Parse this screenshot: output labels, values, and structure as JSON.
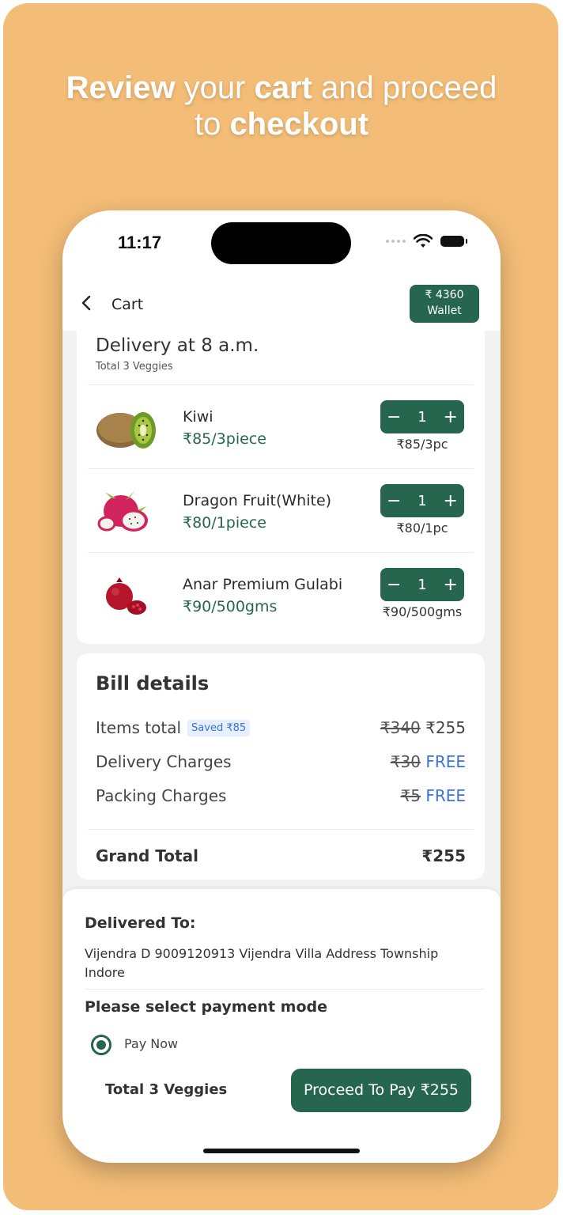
{
  "promo": {
    "w1": "Review",
    "w2": " your ",
    "w3": "cart",
    "w4": " and proceed",
    "w5": "to ",
    "w6": "checkout"
  },
  "status": {
    "time": "11:17"
  },
  "header": {
    "back_icon": "chevron-left",
    "title": "Cart"
  },
  "wallet": {
    "amount": "₹ 4360",
    "label": "Wallet"
  },
  "delivery": {
    "title": "Delivery at 8 a.m.",
    "subtitle": "Total 3 Veggies"
  },
  "items": [
    {
      "name": "Kiwi",
      "price": "₹85/3piece",
      "qty": "1",
      "unit": "₹85/3pc",
      "icon": "kiwi"
    },
    {
      "name": "Dragon Fruit(White)",
      "price": "₹80/1piece",
      "qty": "1",
      "unit": "₹80/1pc",
      "icon": "dragon-fruit"
    },
    {
      "name": "Anar Premium Gulabi",
      "price": "₹90/500gms",
      "qty": "1",
      "unit": "₹90/500gms",
      "icon": "pomegranate"
    }
  ],
  "stepper": {
    "minus": "−",
    "plus": "+"
  },
  "bill": {
    "title": "Bill details",
    "items_total": {
      "label": "Items total",
      "saved": "Saved ₹85",
      "old": "₹340",
      "new": "₹255"
    },
    "delivery": {
      "label": "Delivery Charges",
      "old": "₹30",
      "new": "FREE"
    },
    "packing": {
      "label": "Packing Charges",
      "old": "₹5",
      "new": "FREE"
    },
    "grand": {
      "label": "Grand Total",
      "value": "₹255"
    }
  },
  "delivered_to": {
    "label": "Delivered To:",
    "address": "Vijendra D 9009120913 Vijendra Villa  Address Township Indore"
  },
  "payment": {
    "label": "Please select payment mode",
    "option": "Pay Now"
  },
  "footer": {
    "total": "Total 3 Veggies",
    "button": "Proceed To Pay ₹255"
  },
  "colors": {
    "accent": "#26664e",
    "background": "#f3bd77",
    "free": "#3b73d6"
  }
}
